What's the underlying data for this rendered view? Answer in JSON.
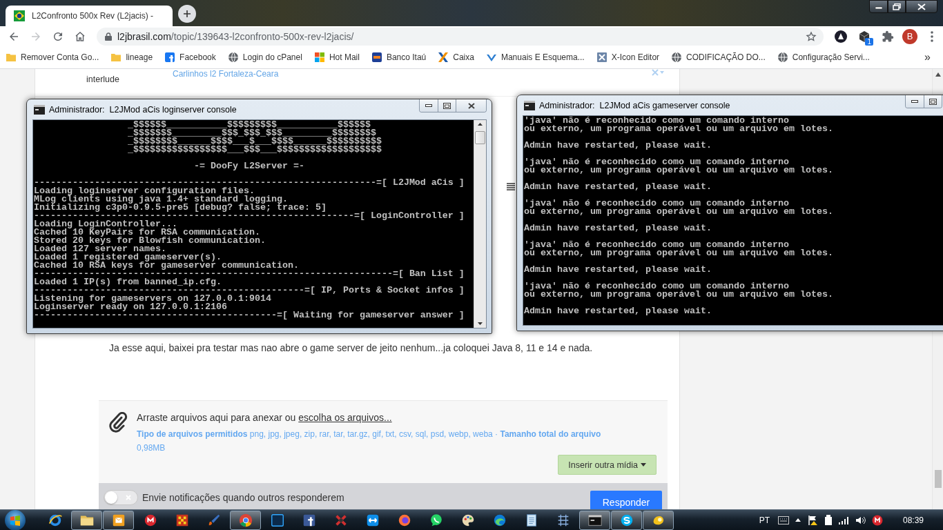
{
  "browser": {
    "tab": {
      "title": "L2Confronto 500x Rev (L2jacis) -"
    },
    "nav": [
      {
        "kind": "back",
        "disabled": false
      },
      {
        "kind": "forward",
        "disabled": true
      },
      {
        "kind": "reload",
        "disabled": false
      },
      {
        "kind": "home",
        "disabled": false
      }
    ],
    "url": {
      "host": "l2jbrasil.com",
      "path": "/topic/139643-l2confronto-500x-rev-l2jacis/"
    },
    "extension_badge": "1",
    "profile_initial": "B",
    "bookmarks": [
      {
        "label": "Remover Conta Go...",
        "kind": "folder"
      },
      {
        "label": "lineage",
        "kind": "folder"
      },
      {
        "label": "Facebook",
        "kind": "facebook"
      },
      {
        "label": "Login do cPanel",
        "kind": "globe"
      },
      {
        "label": "Hot Mail",
        "kind": "windows"
      },
      {
        "label": "Banco Itaú",
        "kind": "bank"
      },
      {
        "label": "Caixa",
        "kind": "cross"
      },
      {
        "label": "Manuais E Esquema...",
        "kind": "check"
      },
      {
        "label": "X-Icon Editor",
        "kind": "xicon"
      },
      {
        "label": "CODIFICAÇÃO DO...",
        "kind": "globe"
      },
      {
        "label": "Configuração Servi...",
        "kind": "globe"
      }
    ],
    "bookmarks_more": "»"
  },
  "page": {
    "top_label": "interlude",
    "top_link": "Carlinhos l2 Fortaleza-Ceara",
    "post": "Ja esse aqui, baixei pra testar mas nao abre o game server de jeito nenhum...ja coloquei Java 8, 11 e 14 e nada.",
    "attach": {
      "prompt": "Arraste arquivos aqui para anexar ou",
      "link": "escolha os arquivos...",
      "types": "**Tipo de arquivos permitidos** png, jpg, jpeg, zip, rar, tar, tar.gz, gif, txt, csv, sql, psd, webp, weba · **Tamanho total do arquivo** 0,98MB"
    },
    "media_button": "Inserir outra mídia",
    "notify": {
      "label": "Envie notificações quando outros responderem",
      "on": false
    },
    "submit": "Responder"
  },
  "consoles": [
    {
      "title": "Administrador:  L2JMod aCis loginserver console",
      "controls": [
        {
          "kind": "minimize"
        },
        {
          "kind": "maximize"
        },
        {
          "kind": "close"
        }
      ],
      "scrollbar": true,
      "blocks": [
        [
          "                 _$$$$$$___________$$$$$$$$$___________$$$$$$",
          "                 _$$$$$$$_________$$$_$$$_$$$_________$$$$$$$$",
          "                 _$$$$$$$$______$$$$___$___$$$$______$$$$$$$$$$",
          "                 _$$$$$$$$$$$$$$$$$___$$$___$$$$$$$$$$$$$$$$$$$"
        ],
        [
          "                             -= DooFy L2Server =-"
        ],
        [
          "--------------------------------------------------------------=[ L2JMod aCis ]",
          "Loading loginserver configuration files.",
          "MLog clients using java 1.4+ standard logging.",
          "Initializing c3p0-0.9.5-pre5 [debug? false; trace: 5]",
          "----------------------------------------------------------=[ LoginController ]",
          "Loading LoginController...",
          "Cached 10 KeyPairs for RSA communication.",
          "Stored 20 keys for Blowfish communication.",
          "Loaded 127 server names.",
          "Loaded 1 registered gameserver(s).",
          "Cached 10 RSA keys for gameserver communication.",
          "-----------------------------------------------------------------=[ Ban List ]",
          "Loaded 1 IP(s) from banned_ip.cfg.",
          "-------------------------------------------------=[ IP, Ports & Socket infos ]",
          "Listening for gameservers on 127.0.0.1:9014",
          "Loginserver ready on 127.0.0.1:2106",
          "--------------------------------------------=[ Waiting for gameserver answer ]"
        ]
      ]
    },
    {
      "title": "Administrador:  L2JMod aCis gameserver console",
      "controls": [
        {
          "kind": "minimize"
        },
        {
          "kind": "maximize"
        }
      ],
      "blocks": [
        [
          "'java' não é reconhecido como um comando interno",
          "ou externo, um programa operável ou um arquivo em lotes."
        ],
        [
          "Admin have restarted, please wait."
        ],
        [
          "'java' não é reconhecido como um comando interno",
          "ou externo, um programa operável ou um arquivo em lotes."
        ],
        [
          "Admin have restarted, please wait."
        ],
        [
          "'java' não é reconhecido como um comando interno",
          "ou externo, um programa operável ou um arquivo em lotes."
        ],
        [
          "Admin have restarted, please wait."
        ],
        [
          "'java' não é reconhecido como um comando interno",
          "ou externo, um programa operável ou um arquivo em lotes."
        ],
        [
          "Admin have restarted, please wait."
        ],
        [
          "'java' não é reconhecido como um comando interno",
          "ou externo, um programa operável ou um arquivo em lotes."
        ],
        [
          "Admin have restarted, please wait."
        ]
      ]
    }
  ],
  "taskbar": {
    "apps": [
      {
        "kind": "ie",
        "open": false
      },
      {
        "kind": "folder",
        "open": true
      },
      {
        "kind": "mail",
        "open": true
      },
      {
        "kind": "mega",
        "open": false
      },
      {
        "kind": "pixel",
        "open": false
      },
      {
        "kind": "brush",
        "open": false
      },
      {
        "kind": "chrome",
        "open": true
      },
      {
        "kind": "ps",
        "open": false
      },
      {
        "kind": "facebook",
        "open": false
      },
      {
        "kind": "xbox",
        "open": false
      },
      {
        "kind": "remote",
        "open": false
      },
      {
        "kind": "firefox",
        "open": false
      },
      {
        "kind": "chat",
        "open": false
      },
      {
        "kind": "palette",
        "open": false
      },
      {
        "kind": "edge",
        "open": false
      },
      {
        "kind": "notepad",
        "open": false
      },
      {
        "kind": "tool",
        "open": false
      },
      {
        "kind": "console",
        "open": true
      },
      {
        "kind": "skype",
        "open": true
      },
      {
        "kind": "swirl",
        "open": true
      }
    ],
    "language": "PT",
    "time": "08:39"
  }
}
